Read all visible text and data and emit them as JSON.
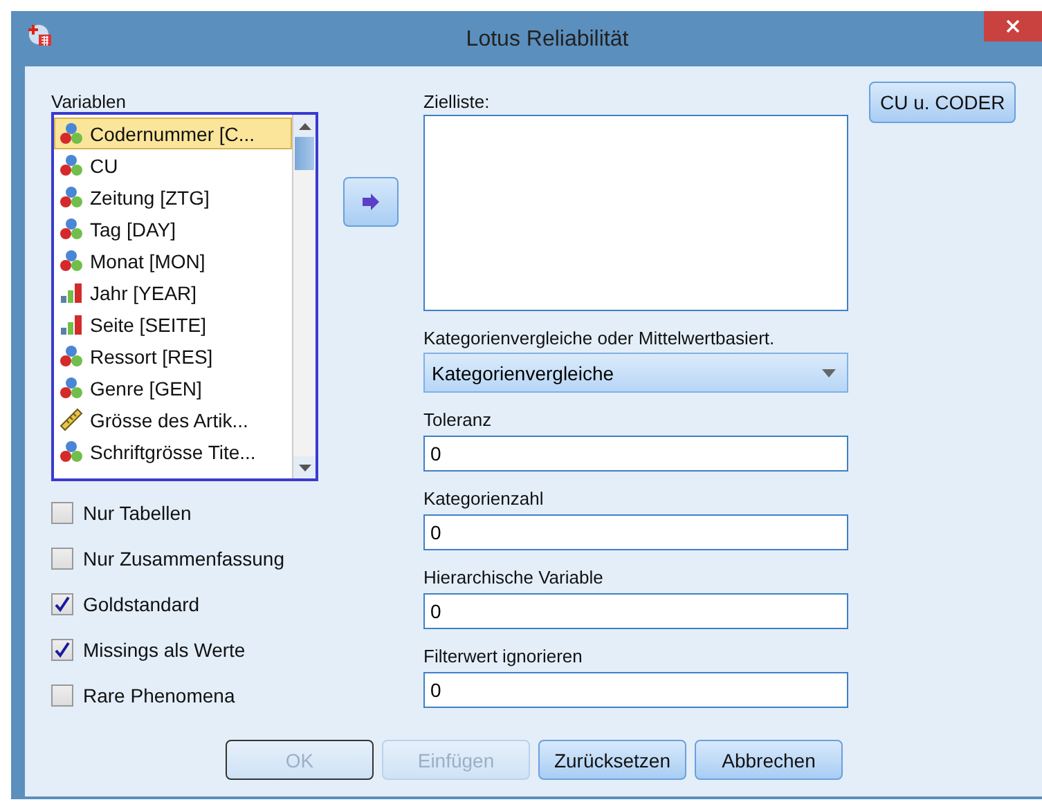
{
  "window": {
    "title": "Lotus Reliabilität"
  },
  "variables": {
    "label": "Variablen",
    "items": [
      {
        "name": "Codernummer [C...",
        "kind": "nominal",
        "selected": true
      },
      {
        "name": "CU",
        "kind": "nominal",
        "selected": false
      },
      {
        "name": "Zeitung [ZTG]",
        "kind": "nominal",
        "selected": false
      },
      {
        "name": "Tag [DAY]",
        "kind": "nominal",
        "selected": false
      },
      {
        "name": "Monat [MON]",
        "kind": "nominal",
        "selected": false
      },
      {
        "name": "Jahr [YEAR]",
        "kind": "ordinal",
        "selected": false
      },
      {
        "name": "Seite [SEITE]",
        "kind": "ordinal",
        "selected": false
      },
      {
        "name": "Ressort [RES]",
        "kind": "nominal",
        "selected": false
      },
      {
        "name": "Genre [GEN]",
        "kind": "nominal",
        "selected": false
      },
      {
        "name": "Grösse des Artik...",
        "kind": "scale",
        "selected": false
      },
      {
        "name": "Schriftgrösse Tite...",
        "kind": "nominal",
        "selected": false
      }
    ]
  },
  "options": [
    {
      "label": "Nur Tabellen",
      "checked": false
    },
    {
      "label": "Nur Zusammenfassung",
      "checked": false
    },
    {
      "label": "Goldstandard",
      "checked": true
    },
    {
      "label": "Missings als Werte",
      "checked": true
    },
    {
      "label": "Rare Phenomena",
      "checked": false
    }
  ],
  "target_list": {
    "label": "Zielliste:"
  },
  "mode": {
    "label": "Kategorienvergleiche oder Mittelwertbasiert.",
    "value": "Kategorienvergleiche"
  },
  "fields": [
    {
      "label": "Toleranz",
      "value": "0"
    },
    {
      "label": "Kategorienzahl",
      "value": "0"
    },
    {
      "label": "Hierarchische Variable",
      "value": "0"
    },
    {
      "label": "Filterwert ignorieren",
      "value": "0"
    }
  ],
  "side_button": "CU u. CODER",
  "buttons": [
    {
      "label": "OK",
      "disabled": true,
      "default": true
    },
    {
      "label": "Einfügen",
      "disabled": true,
      "default": false
    },
    {
      "label": "Zurücksetzen",
      "disabled": false,
      "default": false
    },
    {
      "label": "Abbrechen",
      "disabled": false,
      "default": false
    }
  ]
}
